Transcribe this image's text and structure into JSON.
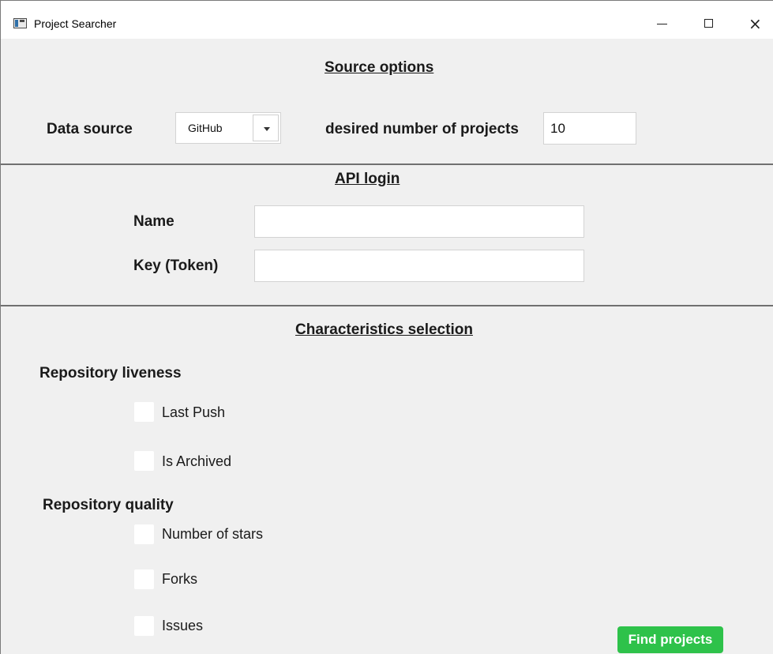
{
  "window": {
    "title": "Project Searcher",
    "minimize_icon": "minimize-icon",
    "maximize_icon": "maximize-icon",
    "close_icon": "close-icon"
  },
  "source_options": {
    "heading": "Source options",
    "data_source_label": "Data source",
    "data_source_value": "GitHub",
    "desired_label": "desired number of projects",
    "desired_value": "10"
  },
  "api_login": {
    "heading": "API login",
    "name_label": "Name",
    "name_value": "",
    "key_label": "Key (Token)",
    "key_value": ""
  },
  "characteristics": {
    "heading": "Characteristics selection",
    "liveness": {
      "heading": "Repository liveness",
      "items": [
        {
          "label": "Last Push",
          "checked": false
        },
        {
          "label": "Is Archived",
          "checked": false
        }
      ]
    },
    "quality": {
      "heading": "Repository quality",
      "items": [
        {
          "label": "Number of stars",
          "checked": false
        },
        {
          "label": "Forks",
          "checked": false
        },
        {
          "label": "Issues",
          "checked": false
        }
      ]
    }
  },
  "actions": {
    "find_label": "Find projects"
  },
  "colors": {
    "find_button": "#2ec24a",
    "background": "#f0f0f0"
  }
}
